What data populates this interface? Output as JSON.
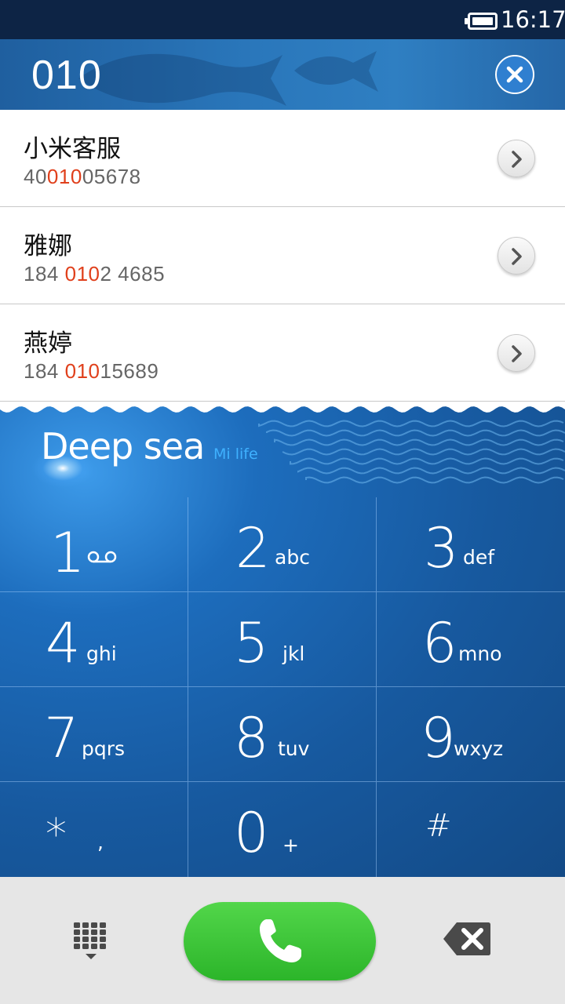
{
  "status_bar": {
    "time": "16:17",
    "battery_icon": "battery-full-icon"
  },
  "number_bar": {
    "typed_number": "010",
    "clear_icon": "close-icon"
  },
  "results": [
    {
      "name": "小米客服",
      "number_parts": [
        "40",
        "010",
        "05678"
      ]
    },
    {
      "name": "雅娜",
      "number_parts": [
        "184 ",
        "010",
        "2 4685"
      ]
    },
    {
      "name": "燕婷",
      "number_parts": [
        "184 ",
        "010",
        "15689"
      ]
    }
  ],
  "theme": {
    "brand": "Deep sea",
    "brand_sub": "Mi life",
    "highlight_color": "#e0401c",
    "call_color": "#3cc53a"
  },
  "keypad": [
    {
      "digit": "1",
      "letters": "voicemail-icon"
    },
    {
      "digit": "2",
      "letters": "abc"
    },
    {
      "digit": "3",
      "letters": "def"
    },
    {
      "digit": "4",
      "letters": "ghi"
    },
    {
      "digit": "5",
      "letters": "jkl"
    },
    {
      "digit": "6",
      "letters": "mno"
    },
    {
      "digit": "7",
      "letters": "pqrs"
    },
    {
      "digit": "8",
      "letters": "tuv"
    },
    {
      "digit": "9",
      "letters": "wxyz"
    },
    {
      "digit": "*",
      "letters": ","
    },
    {
      "digit": "0",
      "letters": "+"
    },
    {
      "digit": "#",
      "letters": ""
    }
  ],
  "bottom_bar": {
    "left_icon": "dialpad-toggle-icon",
    "center_icon": "phone-icon",
    "right_icon": "backspace-icon"
  }
}
